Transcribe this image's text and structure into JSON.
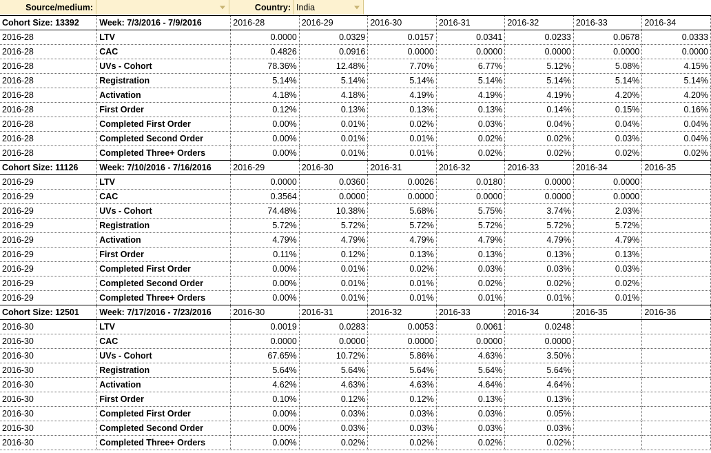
{
  "filters": {
    "source_label": "Source/medium:",
    "source_value": "",
    "country_label": "Country:",
    "country_value": "India",
    "dropdown_icon": "chevron-down-icon"
  },
  "colors": {
    "cohort_header_green": "#d9ead3",
    "week_header_blue": "#c9daf8",
    "filter_yellow": "#fdf2d0",
    "ltv_high_green": "#57bc8a",
    "cac_highlight": "#fce8b2"
  },
  "metrics": [
    "LTV",
    "CAC",
    "UVs - Cohort",
    "Registration",
    "Activation",
    "First Order",
    "Completed First Order",
    "Completed Second Order",
    "Completed Three+ Orders"
  ],
  "blocks": [
    {
      "cohort_size_label": "Cohort Size: 13392",
      "week_label": "Week: 7/3/2016 - 7/9/2016",
      "cohort_id": "2016-28",
      "week_headers": [
        "2016-28",
        "2016-29",
        "2016-30",
        "2016-31",
        "2016-32",
        "2016-33",
        "2016-34"
      ],
      "rows": [
        {
          "metric": "LTV",
          "values": [
            "0.0000",
            "0.0329",
            "0.0157",
            "0.0341",
            "0.0233",
            "0.0678",
            "0.0333"
          ],
          "fills": [
            "g0",
            "g4",
            "g2",
            "g4",
            "g3",
            "g7",
            "g4"
          ]
        },
        {
          "metric": "CAC",
          "values": [
            "0.4826",
            "0.0916",
            "0.0000",
            "0.0000",
            "0.0000",
            "0.0000",
            "0.0000"
          ],
          "fills": [
            "cac-hi",
            "cac-lo",
            "g0",
            "g0",
            "g0",
            "g0",
            "g0"
          ]
        },
        {
          "metric": "UVs - Cohort",
          "values": [
            "78.36%",
            "12.48%",
            "7.70%",
            "6.77%",
            "5.12%",
            "5.08%",
            "4.15%"
          ],
          "fills": [
            "g0",
            "g0",
            "g0",
            "g0",
            "g0",
            "g0",
            "g0"
          ]
        },
        {
          "metric": "Registration",
          "values": [
            "5.14%",
            "5.14%",
            "5.14%",
            "5.14%",
            "5.14%",
            "5.14%",
            "5.14%"
          ],
          "fills": [
            "g0",
            "g0",
            "g0",
            "g0",
            "g0",
            "g0",
            "g0"
          ]
        },
        {
          "metric": "Activation",
          "values": [
            "4.18%",
            "4.18%",
            "4.19%",
            "4.19%",
            "4.19%",
            "4.20%",
            "4.20%"
          ],
          "fills": [
            "g0",
            "g0",
            "g0",
            "g0",
            "g0",
            "g0",
            "g0"
          ]
        },
        {
          "metric": "First Order",
          "values": [
            "0.12%",
            "0.13%",
            "0.13%",
            "0.13%",
            "0.14%",
            "0.15%",
            "0.16%"
          ],
          "fills": [
            "g0",
            "g0",
            "g0",
            "g0",
            "g0",
            "g0",
            "g0"
          ]
        },
        {
          "metric": "Completed First Order",
          "values": [
            "0.00%",
            "0.01%",
            "0.02%",
            "0.03%",
            "0.04%",
            "0.04%",
            "0.04%"
          ],
          "fills": [
            "g0",
            "g0",
            "g0",
            "g0",
            "g0",
            "g0",
            "g0"
          ]
        },
        {
          "metric": "Completed Second Order",
          "values": [
            "0.00%",
            "0.01%",
            "0.01%",
            "0.02%",
            "0.02%",
            "0.03%",
            "0.04%"
          ],
          "fills": [
            "g0",
            "g0",
            "g0",
            "g0",
            "g0",
            "g0",
            "g0"
          ]
        },
        {
          "metric": "Completed Three+ Orders",
          "values": [
            "0.00%",
            "0.01%",
            "0.01%",
            "0.02%",
            "0.02%",
            "0.02%",
            "0.02%"
          ],
          "fills": [
            "g0",
            "g0",
            "g0",
            "g0",
            "g0",
            "g0",
            "g0"
          ]
        }
      ]
    },
    {
      "cohort_size_label": "Cohort Size: 11126",
      "week_label": "Week: 7/10/2016 - 7/16/2016",
      "cohort_id": "2016-29",
      "week_headers": [
        "2016-29",
        "2016-30",
        "2016-31",
        "2016-32",
        "2016-33",
        "2016-34",
        "2016-35"
      ],
      "rows": [
        {
          "metric": "LTV",
          "values": [
            "0.0000",
            "0.0360",
            "0.0026",
            "0.0180",
            "0.0000",
            "0.0000",
            ""
          ],
          "fills": [
            "g0",
            "g5",
            "g1",
            "g3",
            "g0",
            "g0",
            "g0"
          ]
        },
        {
          "metric": "CAC",
          "values": [
            "0.3564",
            "0.0000",
            "0.0000",
            "0.0000",
            "0.0000",
            "0.0000",
            ""
          ],
          "fills": [
            "cac-hi",
            "g0",
            "g0",
            "g0",
            "g0",
            "g0",
            "g0"
          ]
        },
        {
          "metric": "UVs - Cohort",
          "values": [
            "74.48%",
            "10.38%",
            "5.68%",
            "5.75%",
            "3.74%",
            "2.03%",
            ""
          ],
          "fills": [
            "g0",
            "g0",
            "g0",
            "g0",
            "g0",
            "g0",
            "g0"
          ]
        },
        {
          "metric": "Registration",
          "values": [
            "5.72%",
            "5.72%",
            "5.72%",
            "5.72%",
            "5.72%",
            "5.72%",
            ""
          ],
          "fills": [
            "g0",
            "g0",
            "g0",
            "g0",
            "g0",
            "g0",
            "g0"
          ]
        },
        {
          "metric": "Activation",
          "values": [
            "4.79%",
            "4.79%",
            "4.79%",
            "4.79%",
            "4.79%",
            "4.79%",
            ""
          ],
          "fills": [
            "g0",
            "g0",
            "g0",
            "g0",
            "g0",
            "g0",
            "g0"
          ]
        },
        {
          "metric": "First Order",
          "values": [
            "0.11%",
            "0.12%",
            "0.13%",
            "0.13%",
            "0.13%",
            "0.13%",
            ""
          ],
          "fills": [
            "g0",
            "g0",
            "g0",
            "g0",
            "g0",
            "g0",
            "g0"
          ]
        },
        {
          "metric": "Completed First Order",
          "values": [
            "0.00%",
            "0.01%",
            "0.02%",
            "0.03%",
            "0.03%",
            "0.03%",
            ""
          ],
          "fills": [
            "g0",
            "g0",
            "g0",
            "g0",
            "g0",
            "g0",
            "g0"
          ]
        },
        {
          "metric": "Completed Second Order",
          "values": [
            "0.00%",
            "0.01%",
            "0.01%",
            "0.02%",
            "0.02%",
            "0.02%",
            ""
          ],
          "fills": [
            "g0",
            "g0",
            "g0",
            "g0",
            "g0",
            "g0",
            "g0"
          ]
        },
        {
          "metric": "Completed Three+ Orders",
          "values": [
            "0.00%",
            "0.01%",
            "0.01%",
            "0.01%",
            "0.01%",
            "0.01%",
            ""
          ],
          "fills": [
            "g0",
            "g0",
            "g0",
            "g0",
            "g0",
            "g0",
            "g0"
          ]
        }
      ]
    },
    {
      "cohort_size_label": "Cohort Size: 12501",
      "week_label": "Week: 7/17/2016 - 7/23/2016",
      "cohort_id": "2016-30",
      "week_headers": [
        "2016-30",
        "2016-31",
        "2016-32",
        "2016-33",
        "2016-34",
        "2016-35",
        "2016-36"
      ],
      "rows": [
        {
          "metric": "LTV",
          "values": [
            "0.0019",
            "0.0283",
            "0.0053",
            "0.0061",
            "0.0248",
            "",
            ""
          ],
          "fills": [
            "g1",
            "g4",
            "g1",
            "g1",
            "g4",
            "g0",
            "g0"
          ]
        },
        {
          "metric": "CAC",
          "values": [
            "0.0000",
            "0.0000",
            "0.0000",
            "0.0000",
            "0.0000",
            "",
            ""
          ],
          "fills": [
            "g0",
            "g0",
            "g0",
            "g0",
            "g0",
            "g0",
            "g0"
          ]
        },
        {
          "metric": "UVs - Cohort",
          "values": [
            "67.65%",
            "10.72%",
            "5.86%",
            "4.63%",
            "3.50%",
            "",
            ""
          ],
          "fills": [
            "g0",
            "g0",
            "g0",
            "g0",
            "g0",
            "g0",
            "g0"
          ]
        },
        {
          "metric": "Registration",
          "values": [
            "5.64%",
            "5.64%",
            "5.64%",
            "5.64%",
            "5.64%",
            "",
            ""
          ],
          "fills": [
            "g0",
            "g0",
            "g0",
            "g0",
            "g0",
            "g0",
            "g0"
          ]
        },
        {
          "metric": "Activation",
          "values": [
            "4.62%",
            "4.63%",
            "4.63%",
            "4.64%",
            "4.64%",
            "",
            ""
          ],
          "fills": [
            "g0",
            "g0",
            "g0",
            "g0",
            "g0",
            "g0",
            "g0"
          ]
        },
        {
          "metric": "First Order",
          "values": [
            "0.10%",
            "0.12%",
            "0.12%",
            "0.13%",
            "0.13%",
            "",
            ""
          ],
          "fills": [
            "g0",
            "g0",
            "g0",
            "g0",
            "g0",
            "g0",
            "g0"
          ]
        },
        {
          "metric": "Completed First Order",
          "values": [
            "0.00%",
            "0.03%",
            "0.03%",
            "0.03%",
            "0.05%",
            "",
            ""
          ],
          "fills": [
            "g0",
            "g0",
            "g0",
            "g0",
            "g0",
            "g0",
            "g0"
          ]
        },
        {
          "metric": "Completed Second Order",
          "values": [
            "0.00%",
            "0.03%",
            "0.03%",
            "0.03%",
            "0.03%",
            "",
            ""
          ],
          "fills": [
            "g0",
            "g0",
            "g0",
            "g0",
            "g0",
            "g0",
            "g0"
          ]
        },
        {
          "metric": "Completed Three+ Orders",
          "values": [
            "0.00%",
            "0.02%",
            "0.02%",
            "0.02%",
            "0.02%",
            "",
            ""
          ],
          "fills": [
            "g0",
            "g0",
            "g0",
            "g0",
            "g0",
            "g0",
            "g0"
          ]
        }
      ]
    }
  ]
}
